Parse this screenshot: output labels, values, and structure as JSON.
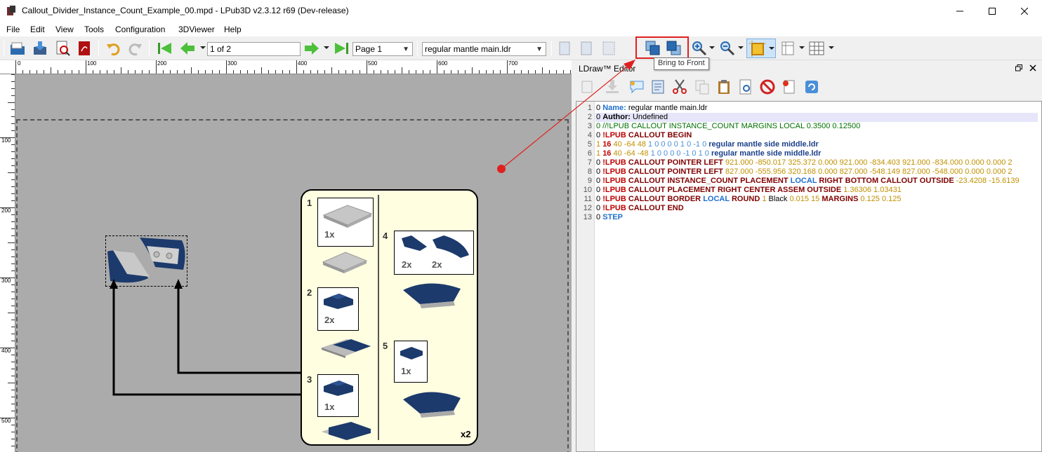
{
  "window": {
    "title": "Callout_Divider_Instance_Count_Example_00.mpd - LPub3D v2.3.12 r69 (Dev-release)"
  },
  "menu": [
    "File",
    "Edit",
    "View",
    "Tools",
    "Configuration",
    "3DViewer",
    "Help"
  ],
  "toolbar": {
    "page_field": "1 of 2",
    "page_combo": "Page 1",
    "model_combo": "regular mantle main.ldr",
    "tooltip": "Bring to Front"
  },
  "ruler": {
    "top_marks": [
      "0",
      "100",
      "200",
      "300",
      "400",
      "500",
      "600",
      "700"
    ],
    "left_marks": [
      "100",
      "200",
      "300",
      "400",
      "500"
    ]
  },
  "callout": {
    "steps": [
      "1",
      "2",
      "3",
      "4",
      "5"
    ],
    "qty": [
      "1x",
      "2x",
      "1x",
      "2x",
      "2x",
      "1x"
    ],
    "instance_count": "x2"
  },
  "editor": {
    "title": "LDraw™ Editor",
    "line_numbers": [
      "1",
      "2",
      "3",
      "4",
      "5",
      "6",
      "7",
      "8",
      "9",
      "10",
      "11",
      "12",
      "13"
    ],
    "lines": [
      [
        {
          "t": "0 ",
          "c": ""
        },
        {
          "t": "Name:",
          "c": "bl"
        },
        {
          "t": " regular mantle main.ldr",
          "c": ""
        }
      ],
      [
        {
          "t": "0 ",
          "c": ""
        },
        {
          "t": "Author:",
          "c": "b"
        },
        {
          "t": " Undefined",
          "c": ""
        }
      ],
      [
        {
          "t": "0 //!LPUB CALLOUT INSTANCE_COUNT MARGINS LOCAL 0.3500 0.12500",
          "c": "gr"
        }
      ],
      [
        {
          "t": "0 ",
          "c": ""
        },
        {
          "t": "!LPUB",
          "c": "rd"
        },
        {
          "t": " ",
          "c": ""
        },
        {
          "t": "CALLOUT BEGIN",
          "c": "kw"
        }
      ],
      [
        {
          "t": "1 ",
          "c": "num"
        },
        {
          "t": "16",
          "c": "rd"
        },
        {
          "t": " 40 -64 48 ",
          "c": "num"
        },
        {
          "t": "1 0 0 0 0 1 0 ",
          "c": "blu"
        },
        {
          "t": "-1 0 ",
          "c": "blu"
        },
        {
          "t": "regular mantle side middle.ldr",
          "c": "nv"
        }
      ],
      [
        {
          "t": "1 ",
          "c": "num"
        },
        {
          "t": "16",
          "c": "rd"
        },
        {
          "t": " 40 -64 -48 ",
          "c": "num"
        },
        {
          "t": "1 0 0 0 0 -1 0 1 0 ",
          "c": "blu"
        },
        {
          "t": "regular mantle side middle.ldr",
          "c": "nv"
        }
      ],
      [
        {
          "t": "0 ",
          "c": ""
        },
        {
          "t": "!LPUB",
          "c": "rd"
        },
        {
          "t": " ",
          "c": ""
        },
        {
          "t": "CALLOUT POINTER LEFT",
          "c": "kw"
        },
        {
          "t": " 921.000 -850.017 325.372 0.000 921.000 -834.403 921.000 -834.000 0.000 0.000 2",
          "c": "num"
        }
      ],
      [
        {
          "t": "0 ",
          "c": ""
        },
        {
          "t": "!LPUB",
          "c": "rd"
        },
        {
          "t": " ",
          "c": ""
        },
        {
          "t": "CALLOUT POINTER LEFT",
          "c": "kw"
        },
        {
          "t": " 827.000 -555.956 320.168 0.000 827.000 -548.149 827.000 -548.000 0.000 0.000 2",
          "c": "num"
        }
      ],
      [
        {
          "t": "0 ",
          "c": ""
        },
        {
          "t": "!LPUB",
          "c": "rd"
        },
        {
          "t": " ",
          "c": ""
        },
        {
          "t": "CALLOUT INSTANCE_COUNT PLACEMENT",
          "c": "kw"
        },
        {
          "t": " LOCAL ",
          "c": "bl"
        },
        {
          "t": "RIGHT BOTTOM CALLOUT OUTSIDE",
          "c": "kw"
        },
        {
          "t": " -23.4208 -15.6139",
          "c": "num"
        }
      ],
      [
        {
          "t": "0 ",
          "c": ""
        },
        {
          "t": "!LPUB",
          "c": "rd"
        },
        {
          "t": " ",
          "c": ""
        },
        {
          "t": "CALLOUT PLACEMENT RIGHT CENTER ASSEM OUTSIDE",
          "c": "kw"
        },
        {
          "t": " 1.36306 1.03431",
          "c": "num"
        }
      ],
      [
        {
          "t": "0 ",
          "c": ""
        },
        {
          "t": "!LPUB",
          "c": "rd"
        },
        {
          "t": " ",
          "c": ""
        },
        {
          "t": "CALLOUT BORDER",
          "c": "kw"
        },
        {
          "t": " LOCAL ",
          "c": "bl"
        },
        {
          "t": "ROUND",
          "c": "kw"
        },
        {
          "t": " 1 ",
          "c": "num"
        },
        {
          "t": "Black",
          "c": ""
        },
        {
          "t": " 0.015 15 ",
          "c": "num"
        },
        {
          "t": "MARGINS",
          "c": "kw"
        },
        {
          "t": " 0.125 0.125",
          "c": "num"
        }
      ],
      [
        {
          "t": "0 ",
          "c": ""
        },
        {
          "t": "!LPUB",
          "c": "rd"
        },
        {
          "t": " ",
          "c": ""
        },
        {
          "t": "CALLOUT END",
          "c": "kw"
        }
      ],
      [
        {
          "t": "0 ",
          "c": ""
        },
        {
          "t": "STEP",
          "c": "bl"
        }
      ]
    ]
  },
  "colors": {
    "accent_highlight": "#e02020",
    "brick_blue": "#1c3a6b",
    "callout_bg": "#fffee0"
  }
}
